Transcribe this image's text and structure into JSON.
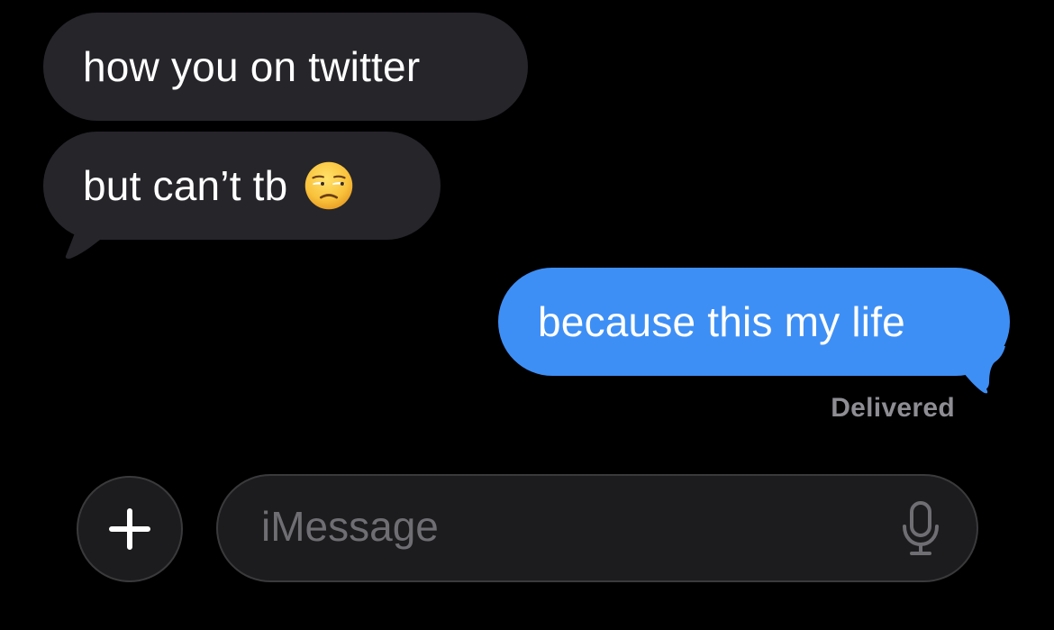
{
  "thread": {
    "messages": [
      {
        "direction": "incoming",
        "text": "how you on twitter"
      },
      {
        "direction": "incoming",
        "text": "but can’t tb",
        "emoji": "unamused-face-icon"
      },
      {
        "direction": "outgoing",
        "text": "because this my life"
      }
    ],
    "status": "Delivered"
  },
  "composer": {
    "placeholder": "iMessage",
    "add_icon": "plus-icon",
    "mic_icon": "microphone-icon"
  },
  "colors": {
    "background": "#000000",
    "incoming_bubble": "#26252a",
    "outgoing_bubble": "#3e8ff5",
    "text": "#ffffff",
    "status_text": "#8d8d93",
    "placeholder_text": "#6e6e73"
  }
}
